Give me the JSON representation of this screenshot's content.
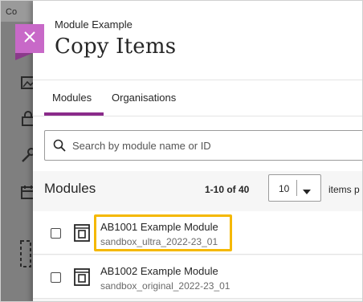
{
  "background": {
    "topbar_text": "Co"
  },
  "panel": {
    "breadcrumb": "Module Example",
    "title": "Copy Items",
    "tabs": [
      {
        "label": "Modules",
        "active": true
      },
      {
        "label": "Organisations",
        "active": false
      }
    ],
    "search": {
      "placeholder": "Search by module name or ID",
      "value": ""
    },
    "list": {
      "heading": "Modules",
      "range": "1-10 of 40",
      "per_page": "10",
      "per_page_label": "items p",
      "rows": [
        {
          "name": "AB1001 Example Module",
          "id": "sandbox_ultra_2022-23_01",
          "checked": false,
          "highlighted": true
        },
        {
          "name": "AB1002 Example Module",
          "id": "sandbox_original_2022-23_01",
          "checked": false,
          "highlighted": false
        }
      ]
    }
  },
  "colors": {
    "accent": "#8a2b8a",
    "close_tab": "#c869c8",
    "highlight": "#f5b800",
    "overlay": "#7f7f7f"
  }
}
